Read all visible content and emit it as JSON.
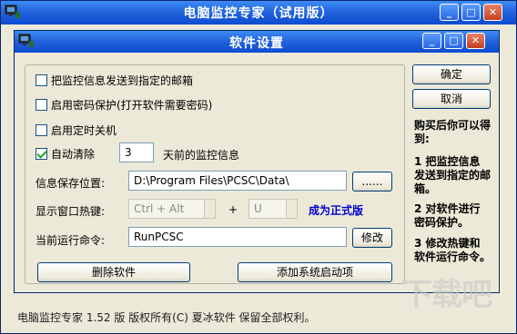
{
  "window": {
    "title": "电脑监控专家（试用版）",
    "min": "_",
    "max": "□",
    "close": "✕"
  },
  "dialog": {
    "title": "软件设置",
    "min": "_",
    "max": "□",
    "close": "✕"
  },
  "options": {
    "send_email": {
      "label": "把监控信息发送到指定的邮箱",
      "checked": false
    },
    "password": {
      "label": "启用密码保护(打开软件需要密码)",
      "checked": false
    },
    "shutdown": {
      "label": "启用定时关机",
      "checked": false
    },
    "auto_clear": {
      "label": "自动清除",
      "checked": true,
      "days": "3",
      "suffix": "天前的监控信息"
    }
  },
  "fields": {
    "save_path_label": "信息保存位置:",
    "save_path_value": "D:\\Program Files\\PCSC\\Data\\",
    "browse": "......",
    "hotkey_label": "显示窗口热键:",
    "hotkey_mod": "Ctrl + Alt",
    "plus": "+",
    "hotkey_key": "U",
    "upgrade_link": "成为正式版",
    "run_cmd_label": "当前运行命令:",
    "run_cmd_value": "RunPCSC",
    "modify": "修改"
  },
  "buttons": {
    "ok": "确定",
    "cancel": "取消",
    "delete": "删除软件",
    "startup": "添加系统启动项"
  },
  "side": {
    "intro": "购买后你可以得到:",
    "item1": "1 把监控信息发送到指定的邮箱。",
    "item2": "2 对软件进行密码保护。",
    "item3": "3 修改热键和软件运行命令。"
  },
  "status": "电脑监控专家  1.52 版  版权所有(C)  夏冰软件  保留全部权利。",
  "watermark": "下载吧"
}
